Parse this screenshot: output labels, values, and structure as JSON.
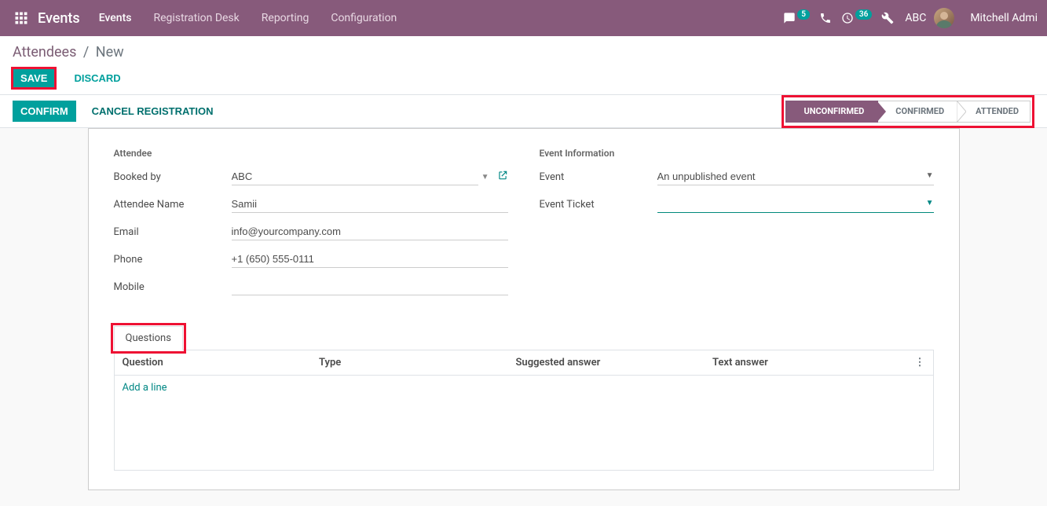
{
  "navbar": {
    "brand": "Events",
    "menus": [
      "Events",
      "Registration Desk",
      "Reporting",
      "Configuration"
    ],
    "active_menu": 0,
    "msg_badge": "5",
    "activity_badge": "36",
    "company": "ABC",
    "user": "Mitchell Admi"
  },
  "breadcrumb": {
    "root": "Attendees",
    "current": "New"
  },
  "buttons": {
    "save": "Save",
    "discard": "Discard",
    "confirm": "Confirm",
    "cancel_reg": "Cancel Registration"
  },
  "status_stages": [
    "Unconfirmed",
    "Confirmed",
    "Attended"
  ],
  "active_stage": 0,
  "attendee": {
    "header": "Attendee",
    "fields": {
      "booked_by_label": "Booked by",
      "booked_by_value": "ABC",
      "name_label": "Attendee Name",
      "name_value": "Samii",
      "email_label": "Email",
      "email_value": "info@yourcompany.com",
      "phone_label": "Phone",
      "phone_value": "+1 (650) 555-0111",
      "mobile_label": "Mobile",
      "mobile_value": ""
    }
  },
  "event_info": {
    "header": "Event Information",
    "fields": {
      "event_label": "Event",
      "event_value": "An unpublished event",
      "ticket_label": "Event Ticket",
      "ticket_value": ""
    }
  },
  "tabs": {
    "questions": {
      "label": "Questions",
      "columns": [
        "Question",
        "Type",
        "Suggested answer",
        "Text answer"
      ],
      "add_line": "Add a line"
    }
  }
}
